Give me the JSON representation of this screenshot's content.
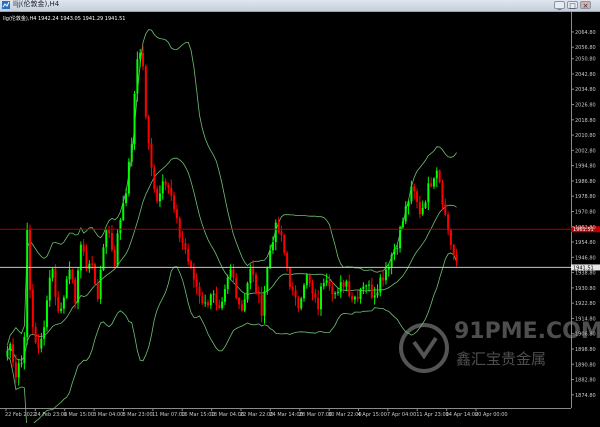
{
  "window": {
    "title": "lljj(伦敦金),H4",
    "btn_min": "_",
    "btn_max": "□",
    "btn_close": "×"
  },
  "chart_info": {
    "symbol_line": "llg(伦敦金),H4  1942.24 1943.05 1941.29 1941.51"
  },
  "colors": {
    "background": "#000000",
    "bull": "#00ff00",
    "bear": "#ff0000",
    "bands": "#6fbf73",
    "hline_red": "#b00000",
    "hline_white": "#c8c8c8"
  },
  "chart_data": {
    "type": "candlestick",
    "timeframe": "H4",
    "ylim": [
      1870,
      2070
    ],
    "price_ticks": [
      "2064.80",
      "2056.80",
      "2050.80",
      "2042.80",
      "2034.80",
      "2026.80",
      "2018.80",
      "2010.80",
      "2002.80",
      "1994.80",
      "1986.80",
      "1978.80",
      "1970.80",
      "1962.80",
      "1954.80",
      "1946.80",
      "1938.80",
      "1930.80",
      "1922.80",
      "1914.80",
      "1906.80",
      "1898.80",
      "1890.80",
      "1882.80",
      "1874.80"
    ],
    "time_ticks": [
      "22 Feb 2022",
      "24 Feb 23:00",
      "1 Mar 15:00",
      "3 Mar 04:00",
      "8 Mar 23:00",
      "11 Mar 07:00",
      "16 Mar 15:00",
      "18 Mar 04:00",
      "22 Mar 22:00",
      "24 Mar 14:00",
      "28 Mar 07:00",
      "30 Mar 22:00",
      "4 Apr 15:00",
      "7 Apr 04:00",
      "11 Apr 23:00",
      "14 Apr 14:00",
      "20 Apr 00:00"
    ],
    "hlines": [
      {
        "price": 1961.5,
        "label": "1961.51",
        "color": "red"
      },
      {
        "price": 1941.5,
        "label": "1941.51",
        "color": "white"
      }
    ],
    "close_path": [
      1898,
      1902,
      1885,
      1893,
      1890,
      1960,
      1915,
      1905,
      1895,
      1910,
      1925,
      1945,
      1930,
      1915,
      1925,
      1940,
      1935,
      1925,
      1945,
      1955,
      1940,
      1945,
      1935,
      1925,
      1950,
      1965,
      1955,
      1945,
      1962,
      1975,
      1985,
      2000,
      2030,
      2060,
      2050,
      2015,
      1995,
      1985,
      1975,
      1990,
      1988,
      1980,
      1970,
      1960,
      1955,
      1950,
      1940,
      1935,
      1930,
      1925,
      1920,
      1930,
      1925,
      1915,
      1920,
      1930,
      1940,
      1935,
      1925,
      1920,
      1930,
      1940,
      1935,
      1925,
      1920,
      1935,
      1950,
      1960,
      1962,
      1955,
      1945,
      1935,
      1925,
      1920,
      1930,
      1938,
      1932,
      1925,
      1920,
      1930,
      1940,
      1935,
      1930,
      1925,
      1932,
      1936,
      1930,
      1925,
      1928,
      1932,
      1935,
      1930,
      1928,
      1932,
      1936,
      1940,
      1945,
      1950,
      1955,
      1962,
      1970,
      1978,
      1982,
      1975,
      1970,
      1978,
      1983,
      1990,
      1995,
      1985,
      1970,
      1960,
      1950,
      1942
    ]
  }
}
